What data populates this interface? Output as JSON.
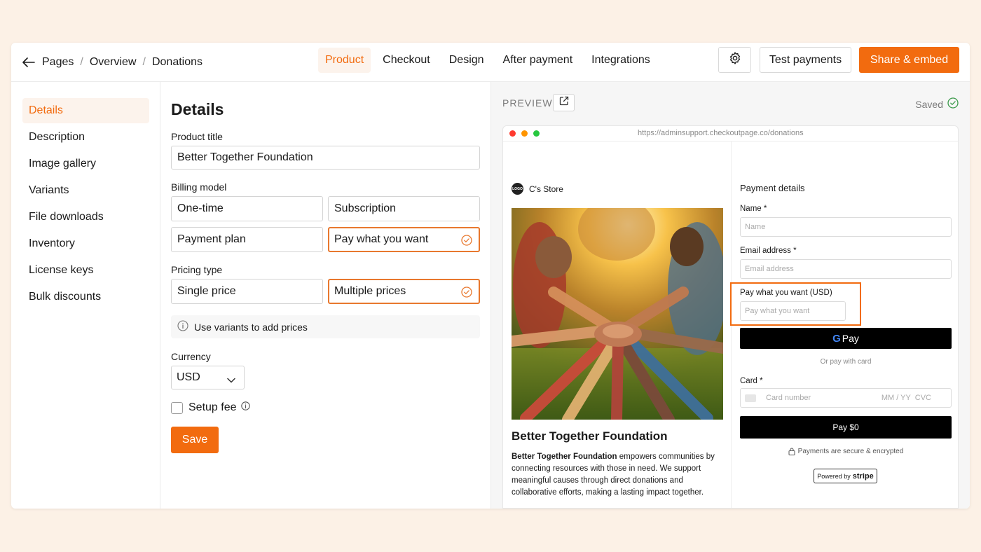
{
  "breadcrumb": {
    "items": [
      "Pages",
      "Overview",
      "Donations"
    ]
  },
  "tabs": [
    "Product",
    "Checkout",
    "Design",
    "After payment",
    "Integrations"
  ],
  "header": {
    "test_label": "Test payments",
    "share_label": "Share & embed"
  },
  "sidebar": {
    "items": [
      "Details",
      "Description",
      "Image gallery",
      "Variants",
      "File downloads",
      "Inventory",
      "License keys",
      "Bulk discounts"
    ]
  },
  "form": {
    "heading": "Details",
    "product_title_label": "Product title",
    "product_title_value": "Better Together Foundation",
    "billing_label": "Billing model",
    "billing_options": [
      "One-time",
      "Subscription",
      "Payment plan",
      "Pay what you want"
    ],
    "pricing_label": "Pricing type",
    "pricing_options": [
      "Single price",
      "Multiple prices"
    ],
    "info_text": "Use variants to add prices",
    "currency_label": "Currency",
    "currency_value": "USD",
    "setup_fee_label": "Setup fee",
    "save_label": "Save"
  },
  "preview": {
    "label": "PREVIEW",
    "saved_label": "Saved",
    "url": "https://adminsupport.checkoutpage.co/donations",
    "store_name": "C's Store",
    "logo_text": "LOGO",
    "product_title": "Better Together Foundation",
    "desc_bold": "Better Together Foundation",
    "desc_rest": " empowers communities by connecting resources with those in need. We support meaningful causes through direct donations and collaborative efforts, making a lasting impact together.",
    "payment_heading": "Payment details",
    "name_label": "Name",
    "name_placeholder": "Name",
    "email_label": "Email address",
    "email_placeholder": "Email address",
    "pwyw_label": "Pay what you want (USD)",
    "pwyw_placeholder": "Pay what you want",
    "gpay_g": "G",
    "gpay_label": "Pay",
    "or_text": "Or pay with card",
    "card_label": "Card",
    "card_number": "Card number",
    "card_exp": "MM / YY  CVC",
    "pay_button": "Pay $0",
    "secure_text": "Payments are secure & encrypted",
    "powered_by": "Powered by",
    "stripe": "stripe"
  },
  "colors": {
    "accent": "#f26b0f",
    "success": "#3a9a4a"
  }
}
